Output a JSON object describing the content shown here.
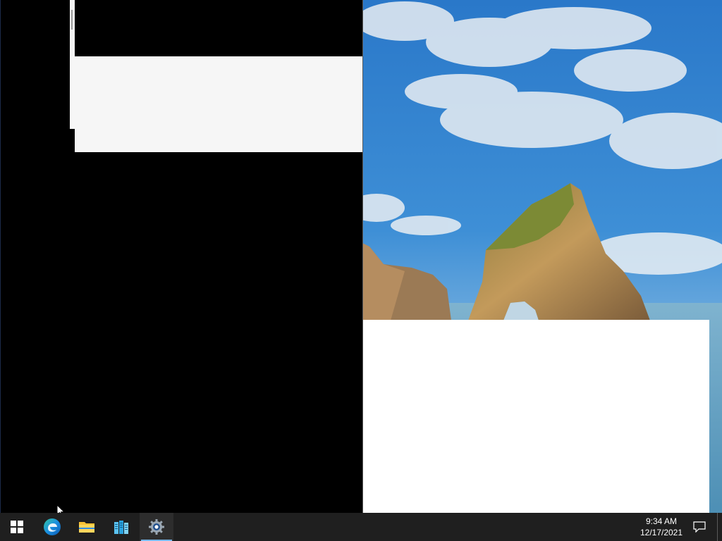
{
  "desktop": {
    "wallpaper": "sea-arch-rock-wallpaper"
  },
  "taskbar": {
    "items": [
      {
        "name": "start-button",
        "icon": "windows-logo-icon"
      },
      {
        "name": "edge-button",
        "icon": "edge-icon"
      },
      {
        "name": "file-explorer-button",
        "icon": "folder-icon"
      },
      {
        "name": "server-manager-button",
        "icon": "server-manager-icon"
      },
      {
        "name": "settings-button",
        "icon": "gear-icon",
        "active": true
      }
    ],
    "clock": {
      "time": "9:34 AM",
      "date": "12/17/2021"
    },
    "notification_icon": "action-center-icon"
  },
  "colors": {
    "taskbar_bg": "#1f1f1f",
    "active_indicator": "#76b9ed",
    "window_white": "#ffffff",
    "panel_grey": "#f6f6f6"
  }
}
